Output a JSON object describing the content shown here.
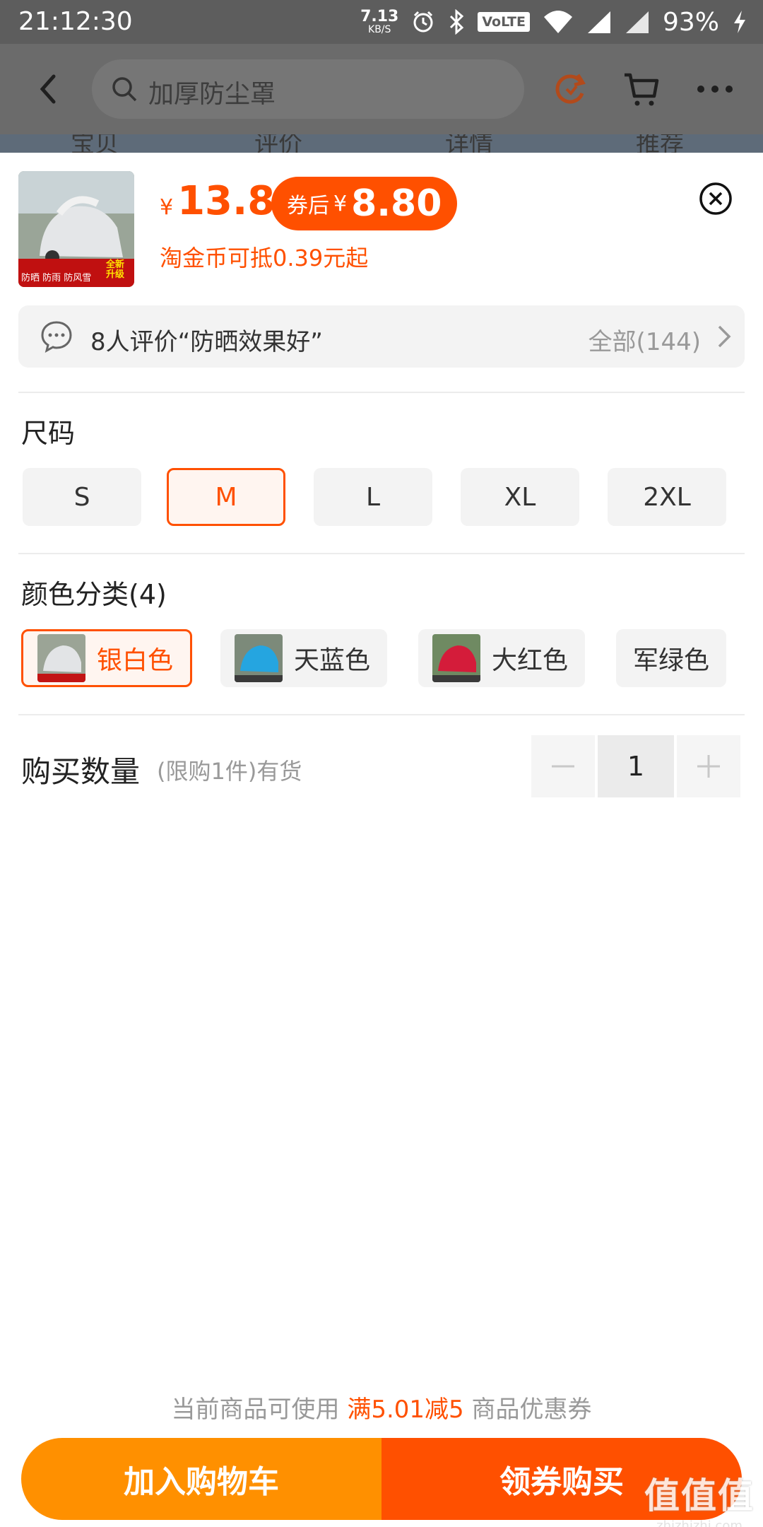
{
  "status_bar": {
    "time": "21:12:30",
    "net_speed": "7.13",
    "net_unit": "KB/S",
    "volte": "VoLTE",
    "battery": "93%"
  },
  "header": {
    "search_text": "加厚防尘罩"
  },
  "tabs_peek": [
    "宝贝",
    "评价",
    "详情",
    "推荐"
  ],
  "product": {
    "currency": "¥",
    "price": "13.8",
    "coupon_label": "券后",
    "coupon_price": "8.80",
    "coin_note": "淘金币可抵0.39元起",
    "thumb_tags": [
      "防晒 防雨 防风雪",
      "全新升级"
    ]
  },
  "review": {
    "text": "8人评价“防晒效果好”",
    "all": "全部(144)"
  },
  "size": {
    "title": "尺码",
    "options": [
      "S",
      "M",
      "L",
      "XL",
      "2XL"
    ],
    "selected": "M"
  },
  "color": {
    "title": "颜色分类(4)",
    "options": [
      "银白色",
      "天蓝色",
      "大红色",
      "军绿色"
    ],
    "selected": "银白色"
  },
  "quantity": {
    "label": "购买数量",
    "note": "(限购1件)有货",
    "value": "1"
  },
  "promo": {
    "prefix": "当前商品可使用 ",
    "highlight": "满5.01减5",
    "suffix": " 商品优惠券"
  },
  "actions": {
    "add_to_cart": "加入购物车",
    "buy": "领券购买"
  },
  "watermark": {
    "big": "值值值",
    "small": "zhizhizhi.com"
  },
  "colors": {
    "accent": "#ff5000",
    "cart": "#ff9000"
  }
}
